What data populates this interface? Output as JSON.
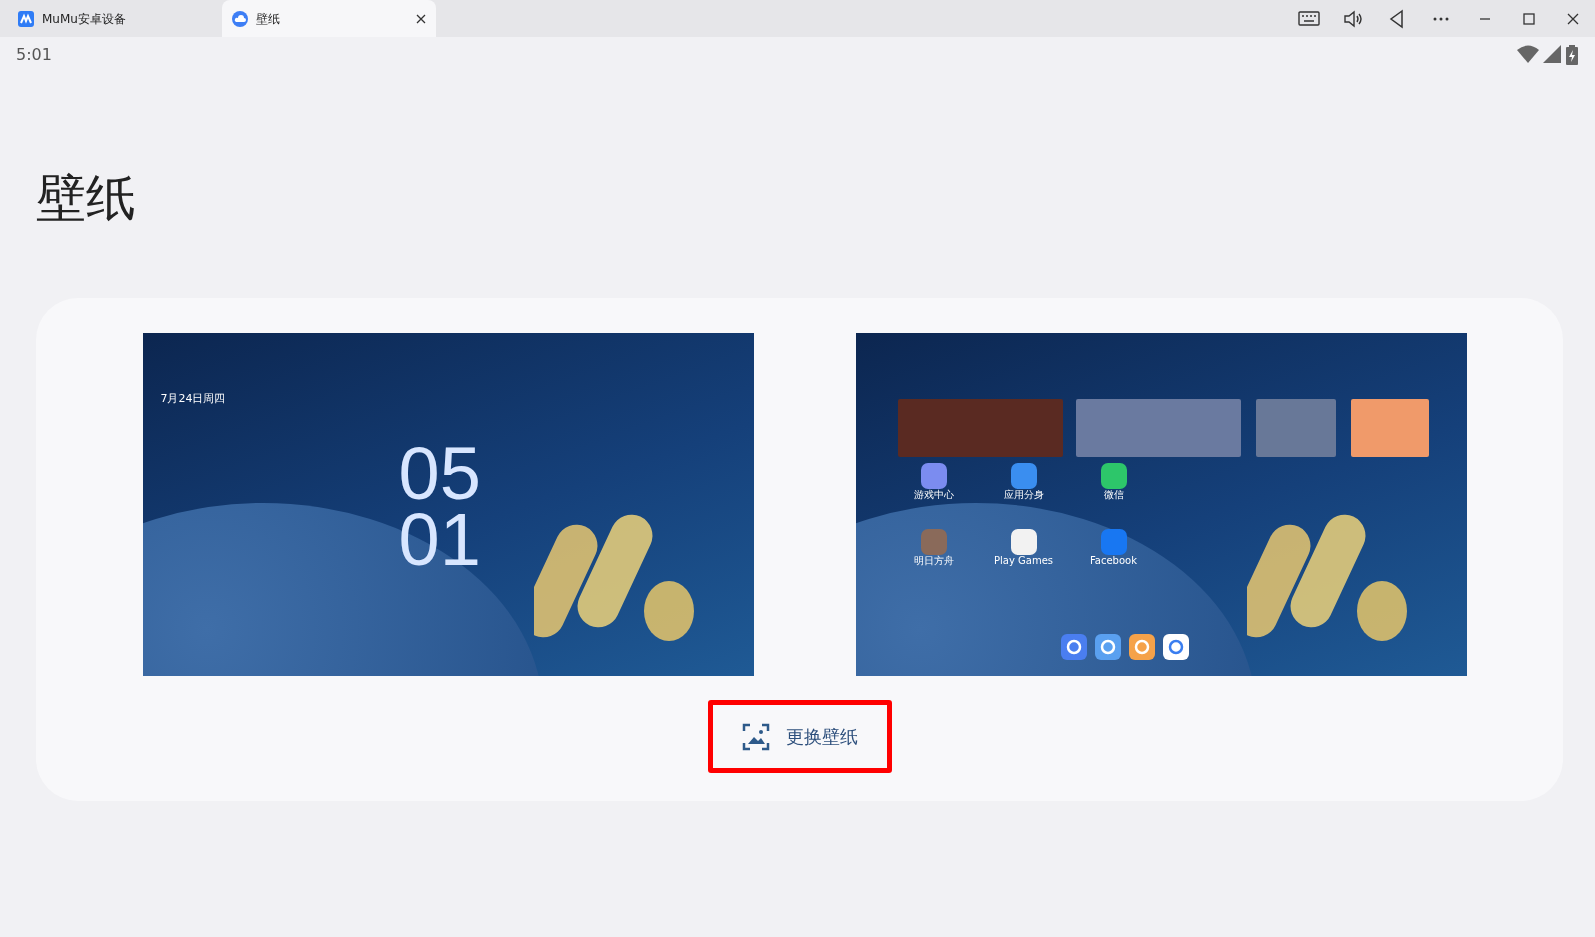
{
  "window": {
    "tabs": [
      {
        "label": "MuMu安卓设备",
        "selected": false
      },
      {
        "label": "壁纸",
        "selected": true,
        "closable": true
      }
    ]
  },
  "status_bar": {
    "time": "5:01"
  },
  "page": {
    "title": "壁纸"
  },
  "lock_preview": {
    "date": "7月24日周四",
    "hour": "05",
    "minute": "01"
  },
  "home_preview": {
    "apps": [
      {
        "label": "游戏中心",
        "color": "#7b8cf0"
      },
      {
        "label": "应用分身",
        "color": "#3a8ef0"
      },
      {
        "label": "微信",
        "color": "#2dc66a"
      },
      {
        "label": "明日方舟",
        "color": "#8a6a5a"
      },
      {
        "label": "Play Games",
        "color": "#f2f2f2"
      },
      {
        "label": "Facebook",
        "color": "#1877f2"
      }
    ]
  },
  "change_button": {
    "label": "更换壁纸",
    "highlighted": true
  }
}
